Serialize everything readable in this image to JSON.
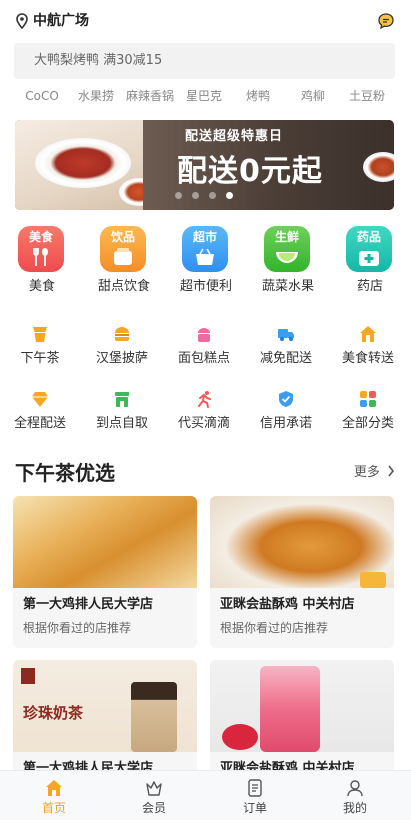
{
  "header": {
    "location": "中航广场",
    "location_icon": "location-pin-icon",
    "message_icon": "message-bubble-icon"
  },
  "search": {
    "text": "大鸭梨烤鸭 满30减15"
  },
  "hot_words": [
    "CoCO",
    "水果捞",
    "麻辣香锅",
    "星巴克",
    "烤鸭",
    "鸡柳",
    "土豆粉"
  ],
  "banner": {
    "subtitle": "配送超级特惠日",
    "headline": "配送0元起",
    "slides": 4,
    "active_slide": 4
  },
  "big_categories": [
    {
      "tag": "美食",
      "label": "美食",
      "icon": "fork-spoon-icon",
      "color": "#f0595a"
    },
    {
      "tag": "饮品",
      "label": "甜点饮食",
      "icon": "drink-cup-icon",
      "color": "#f7a13a"
    },
    {
      "tag": "超市",
      "label": "超市便利",
      "icon": "shopping-basket-icon",
      "color": "#3d9ff2"
    },
    {
      "tag": "生鲜",
      "label": "蔬菜水果",
      "icon": "lime-fruit-icon",
      "color": "#4cc53a"
    },
    {
      "tag": "药品",
      "label": "药店",
      "icon": "medical-kit-icon",
      "color": "#27c4b4"
    }
  ],
  "small_categories": [
    {
      "label": "下午茶",
      "icon": "tea-cup-icon",
      "color": "#f5a623"
    },
    {
      "label": "汉堡披萨",
      "icon": "burger-icon",
      "color": "#f5a623"
    },
    {
      "label": "面包糕点",
      "icon": "cake-icon",
      "color": "#f06aa0"
    },
    {
      "label": "减免配送",
      "icon": "delivery-truck-icon",
      "color": "#3a9df0"
    },
    {
      "label": "美食转送",
      "icon": "food-home-icon",
      "color": "#f5a623"
    },
    {
      "label": "全程配送",
      "icon": "diamond-icon",
      "color": "#f5a623"
    },
    {
      "label": "到点自取",
      "icon": "pickup-store-icon",
      "color": "#3cba54"
    },
    {
      "label": "代买滴滴",
      "icon": "runner-icon",
      "color": "#f05a5a"
    },
    {
      "label": "信用承诺",
      "icon": "shield-check-icon",
      "color": "#3a9df0"
    },
    {
      "label": "全部分类",
      "icon": "grid-apps-icon",
      "color": "#f5a623"
    }
  ],
  "section": {
    "title": "下午茶优选",
    "more": "更多"
  },
  "cards": [
    {
      "name": "第一大鸡排人民大学店",
      "desc": "根据你看过的店推荐",
      "image": "fried-chicken-cutlet-photo"
    },
    {
      "name": "亚眯会盐酥鸡 中关村店",
      "desc": "根据你看过的店推荐",
      "image": "popcorn-chicken-photo"
    },
    {
      "name": "第一大鸡排人民大学店",
      "desc": "",
      "image": "pearl-milk-tea-photo",
      "image_text": "珍珠奶茶"
    },
    {
      "name": "亚眯会盐酥鸡 中关村店",
      "desc": "",
      "image": "strawberry-drink-photo"
    }
  ],
  "tabbar": [
    {
      "label": "首页",
      "icon": "home-icon",
      "active": true
    },
    {
      "label": "会员",
      "icon": "crown-icon",
      "active": false
    },
    {
      "label": "订单",
      "icon": "order-list-icon",
      "active": false
    },
    {
      "label": "我的",
      "icon": "user-icon",
      "active": false
    }
  ],
  "colors": {
    "accent": "#f0a020",
    "search_bg": "#f2f2f2"
  }
}
